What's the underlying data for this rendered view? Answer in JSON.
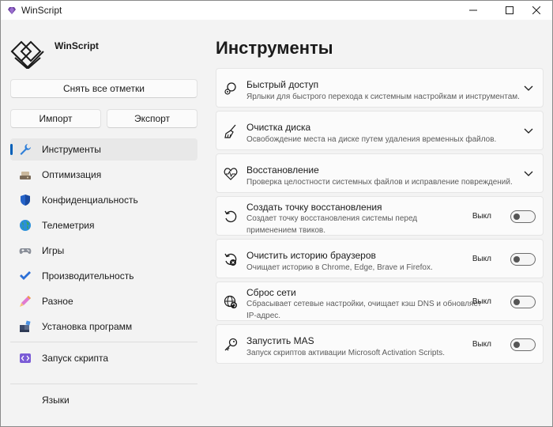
{
  "window": {
    "title": "WinScript"
  },
  "sidebar": {
    "brand": "WinScript",
    "clear_all_label": "Снять все отметки",
    "import_label": "Импорт",
    "export_label": "Экспорт",
    "items": [
      {
        "label": "Инструменты",
        "icon": "wrench-icon",
        "active": true
      },
      {
        "label": "Оптимизация",
        "icon": "optimization-icon"
      },
      {
        "label": "Конфиденциальность",
        "icon": "shield-icon"
      },
      {
        "label": "Телеметрия",
        "icon": "globe-icon"
      },
      {
        "label": "Игры",
        "icon": "gamepad-icon"
      },
      {
        "label": "Производительность",
        "icon": "checkmark-icon"
      },
      {
        "label": "Разное",
        "icon": "pencil-icon"
      },
      {
        "label": "Установка программ",
        "icon": "apps-icon"
      }
    ],
    "run_script_label": "Запуск скрипта",
    "languages_label": "Языки"
  },
  "main": {
    "title": "Инструменты",
    "cards": [
      {
        "title": "Быстрый доступ",
        "desc": "Ярлыки для быстрого перехода к системным настройкам и инструментам.",
        "icon": "search-gear-icon",
        "type": "expander"
      },
      {
        "title": "Очистка диска",
        "desc": "Освобождение места на диске путем удаления временных файлов.",
        "icon": "broom-icon",
        "type": "expander"
      },
      {
        "title": "Восстановление",
        "desc": "Проверка целостности системных файлов и исправление повреждений.",
        "icon": "heart-pulse-icon",
        "type": "expander"
      },
      {
        "title": "Создать точку восстановления",
        "desc": "Создает точку восстановления системы перед применением твиков.",
        "icon": "restore-icon",
        "type": "toggle",
        "state_label": "Выкл",
        "on": false
      },
      {
        "title": "Очистить историю браузеров",
        "desc": "Очищает историю в Chrome, Edge, Brave и Firefox.",
        "icon": "history-clear-icon",
        "type": "toggle",
        "state_label": "Выкл",
        "on": false
      },
      {
        "title": "Сброс сети",
        "desc": "Сбрасывает сетевые настройки, очищает кэш DNS и обновляет IP-адрес.",
        "icon": "network-reset-icon",
        "type": "toggle",
        "state_label": "Выкл",
        "on": false
      },
      {
        "title": "Запустить MAS",
        "desc": "Запуск скриптов активации Microsoft Activation Scripts.",
        "icon": "key-icon",
        "type": "toggle",
        "state_label": "Выкл",
        "on": false
      }
    ]
  },
  "colors": {
    "accent": "#005fb8",
    "background": "#f3f3f3",
    "card": "#fbfbfb"
  }
}
